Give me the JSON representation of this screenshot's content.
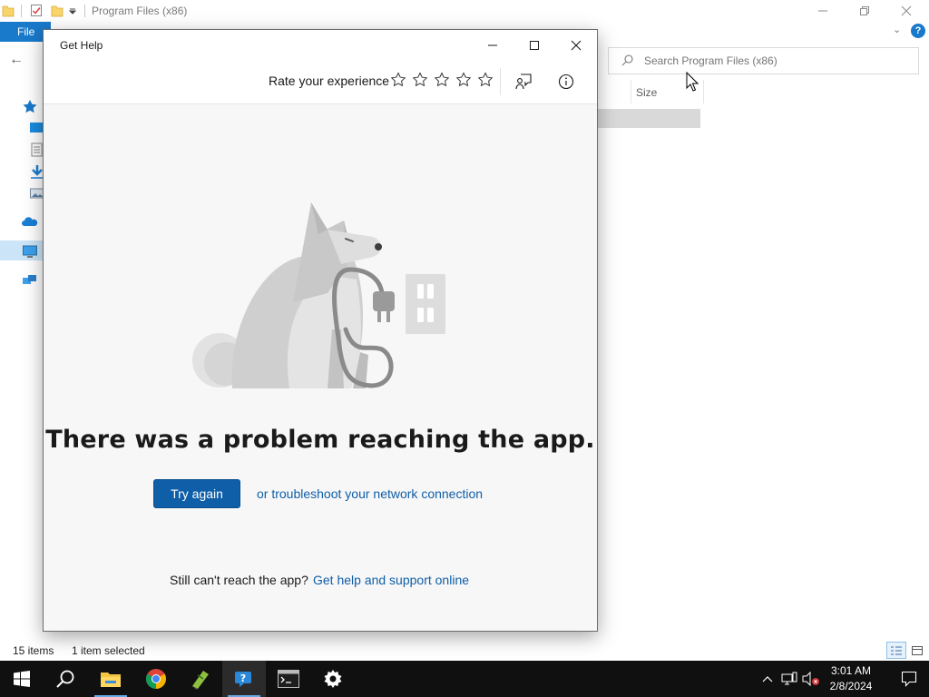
{
  "explorer": {
    "title": "Program Files (x86)",
    "file_tab": "File",
    "search_placeholder": "Search Program Files (x86)",
    "column_size": "Size",
    "status_items": "15 items",
    "status_selected": "1 item selected",
    "help_glyph": "?"
  },
  "gethelp": {
    "title": "Get Help",
    "rate_label": "Rate your experience",
    "star_count": 5,
    "heading": "There was a problem reaching the app.",
    "try_again": "Try again",
    "troubleshoot": "or troubleshoot your network connection",
    "still_text": "Still can't reach the app?",
    "support_link": "Get help and support online"
  },
  "taskbar": {
    "time": "3:01 AM",
    "date": "2/8/2024"
  },
  "colors": {
    "accent": "#0f5ea8",
    "explorer_blue": "#1979ca",
    "taskbar": "#101010"
  }
}
